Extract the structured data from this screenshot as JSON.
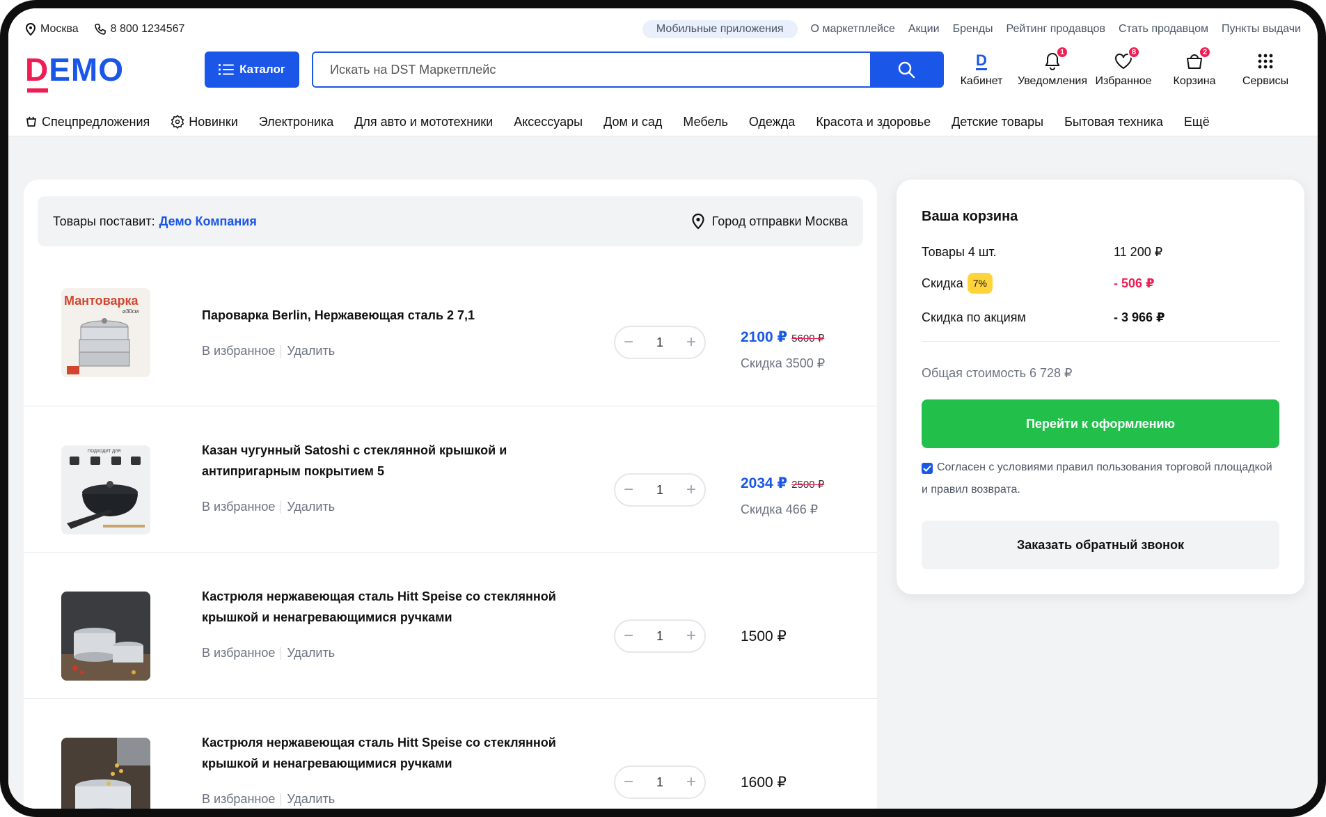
{
  "topbar": {
    "city": "Москва",
    "phone": "8 800 1234567",
    "links": [
      "Мобильные приложения",
      "О маркетплейсе",
      "Акции",
      "Бренды",
      "Рейтинг продавцов",
      "Стать продавцом",
      "Пункты выдачи"
    ]
  },
  "logo": {
    "prefix": "D",
    "rest": "EMO"
  },
  "catalog_label": "Каталог",
  "search": {
    "placeholder": "Искать на DST Маркетплейс"
  },
  "nav_icons": [
    {
      "label": "Кабинет",
      "icon": "user-d-icon"
    },
    {
      "label": "Уведомления",
      "icon": "bell-icon",
      "badge": "1"
    },
    {
      "label": "Избранное",
      "icon": "heart-icon",
      "badge": "8"
    },
    {
      "label": "Корзина",
      "icon": "cart-icon",
      "badge": "2"
    },
    {
      "label": "Сервисы",
      "icon": "grid-icon"
    }
  ],
  "categories": [
    "Спецпредложения",
    "Новинки",
    "Электроника",
    "Для авто и мототехники",
    "Аксессуары",
    "Дом и сад",
    "Мебель",
    "Одежда",
    "Красота и здоровье",
    "Детские товары",
    "Бытовая техника",
    "Ещё"
  ],
  "supplier": {
    "label": "Товары поставит:",
    "company": "Демо Компания",
    "city": "Город отправки Москва"
  },
  "item_actions": {
    "favorite": "В избранное",
    "remove": "Удалить"
  },
  "items": [
    {
      "name_lines": [
        "Пароварка Berlin, Нержавеющая сталь 2 7,1"
      ],
      "qty": "1",
      "price": "2100 ₽",
      "old_price": "5600 ₽",
      "discount": "Скидка 3500 ₽",
      "thumb_label": "Мантоварка",
      "thumb_sub": "⌀30см"
    },
    {
      "name_lines": [
        "Казан чугунный Satoshi с стеклянной крышкой и",
        "антипригарным покрытием 5"
      ],
      "qty": "1",
      "price": "2034 ₽",
      "old_price": "2500 ₽",
      "discount": "Скидка 466 ₽",
      "thumb_label": "ПОДХОДИТ ДЛЯ"
    },
    {
      "name_lines": [
        "Кастрюля нержавеющая сталь Hitt Speise со стеклянной",
        "крышкой и ненагревающимися ручками"
      ],
      "qty": "1",
      "price": "1500 ₽"
    },
    {
      "name_lines": [
        "Кастрюля нержавеющая сталь Hitt Speise со стеклянной",
        "крышкой и ненагревающимися ручками"
      ],
      "qty": "1",
      "price": "1600 ₽"
    }
  ],
  "summary": {
    "title": "Ваша корзина",
    "goods_label": "Товары 4 шт.",
    "goods_value": "11 200 ₽",
    "discount_label": "Скидка",
    "discount_pct": "7%",
    "discount_value": "- 506 ₽",
    "promo_label": "Скидка по акциям",
    "promo_value": "- 3 966 ₽",
    "total": "Общая стоимость 6 728 ₽",
    "checkout": "Перейти к оформлению",
    "agree": "Согласен с условиями правил пользования торговой площадкой и правил возврата.",
    "callback": "Заказать обратный звонок"
  },
  "colors": {
    "accent": "#1a56e8",
    "brand_red": "#ee1d52",
    "green": "#22c04a",
    "badge_yellow": "#ffd43b"
  }
}
